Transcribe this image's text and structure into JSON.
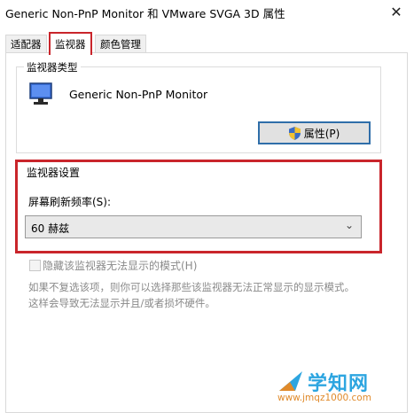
{
  "window": {
    "title": "Generic Non-PnP Monitor 和 VMware SVGA 3D 属性",
    "close_glyph": "✕"
  },
  "tabs": [
    {
      "label": "适配器",
      "active": false
    },
    {
      "label": "监视器",
      "active": true
    },
    {
      "label": "颜色管理",
      "active": false
    }
  ],
  "monitor_type": {
    "group_label": "监视器类型",
    "monitor_name": "Generic Non-PnP Monitor",
    "properties_button": "属性(P)",
    "properties_icon": "shield-icon"
  },
  "monitor_settings": {
    "group_label": "监视器设置",
    "refresh_label": "屏幕刷新频率(S):",
    "refresh_value": "60 赫兹",
    "hide_modes_label": "隐藏该监视器无法显示的模式(H)",
    "hide_modes_checked": false,
    "description_line1": "如果不复选该项，则你可以选择那些该监视器无法正常显示的显示模式。",
    "description_line2": "这样会导致无法显示并且/或者损坏硬件。"
  },
  "watermark": {
    "brand": "学知网",
    "url": "www.jmqz1000.com"
  },
  "colors": {
    "highlight_red": "#c9252b",
    "button_focus_blue": "#2f6ea9"
  }
}
